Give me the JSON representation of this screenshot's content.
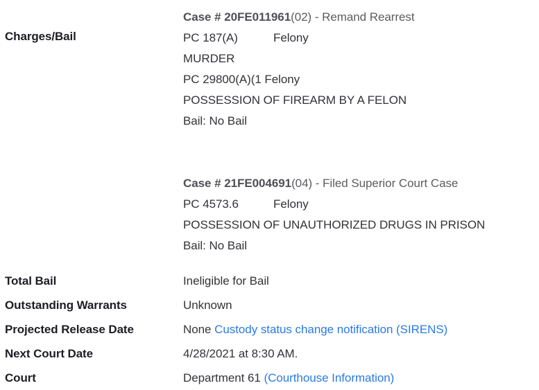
{
  "charges": {
    "label": "Charges/Bail",
    "cases": [
      {
        "case_prefix": "Case # 20FE011961",
        "case_suffix": "(02) - Remand Rearrest",
        "charges": [
          {
            "code": "PC 187(A)",
            "class": "Felony",
            "description": "MURDER"
          },
          {
            "code": "PC 29800(A)(1 Felony",
            "class": "",
            "description": "POSSESSION OF FIREARM BY A FELON"
          }
        ],
        "bail": "Bail: No Bail"
      },
      {
        "case_prefix": "Case # 21FE004691",
        "case_suffix": "(04) - Filed Superior Court Case",
        "charges": [
          {
            "code": "PC 4573.6",
            "class": "Felony",
            "description": "POSSESSION OF UNAUTHORIZED DRUGS IN PRISON"
          }
        ],
        "bail": "Bail: No Bail"
      }
    ]
  },
  "fields": {
    "total_bail": {
      "label": "Total Bail",
      "value": "Ineligible for Bail"
    },
    "outstanding_warrants": {
      "label": "Outstanding Warrants",
      "value": "Unknown"
    },
    "projected_release_date": {
      "label": "Projected Release Date",
      "value": "None",
      "link_text": "Custody status change notification (SIRENS)"
    },
    "next_court_date": {
      "label": "Next Court Date",
      "value": "4/28/2021 at 8:30 AM."
    },
    "court": {
      "label": "Court",
      "value": "Department 61",
      "link_text": "(Courthouse Information)"
    }
  },
  "colors": {
    "link": "#2a7ae4",
    "label": "#1d1d24",
    "value": "#333338",
    "case_heading": "#5c5c60"
  }
}
